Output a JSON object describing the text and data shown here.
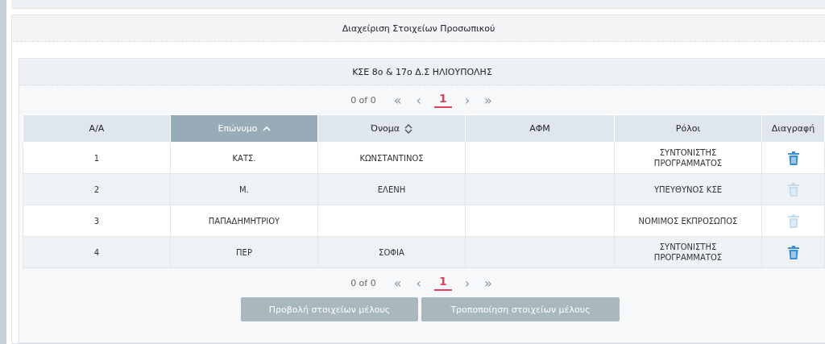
{
  "panel": {
    "title": "Διαχείριση Στοιχείων Προσωπικού"
  },
  "group": {
    "title": "ΚΣΕ 8ο & 17ο Δ.Σ ΗΛΙΟΥΠΟΛΗΣ"
  },
  "pager_top": {
    "count": "0 of 0",
    "first": "«",
    "prev": "‹",
    "pages": [
      {
        "label": "1",
        "selected": true
      }
    ],
    "next": "›",
    "last": "»"
  },
  "table": {
    "columns": [
      {
        "label": "Α/Α",
        "kind": "plain",
        "selected": false
      },
      {
        "label": "Επώνυμο",
        "kind": "sorted",
        "selected": true
      },
      {
        "label": "Όνομα",
        "kind": "sortable",
        "selected": false
      },
      {
        "label": "ΑΦΜ",
        "kind": "plain",
        "selected": false
      },
      {
        "label": "Ρόλοι",
        "kind": "plain",
        "selected": false
      },
      {
        "label": "Διαγραφή",
        "kind": "plain",
        "selected": false
      }
    ],
    "rows": [
      {
        "cells": [
          "1",
          "ΚΑΤΣ.",
          "ΚΩΝΣΤΑΝΤΙΝΟΣ",
          "",
          "ΣΥΝΤΟΝΙΣΤΗΣ ΠΡΟΓΡΑΜΜΑΤΟΣ"
        ],
        "delete_disabled": false
      },
      {
        "cells": [
          "2",
          "Μ.",
          "ΕΛΕΝΗ",
          "",
          "ΥΠΕΥΘΥΝΟΣ ΚΣΕ"
        ],
        "delete_disabled": true
      },
      {
        "cells": [
          "3",
          "ΠΑΠΑΔΗΜΗΤΡΙΟΥ",
          "",
          "",
          "ΝΟΜΙΜΟΣ ΕΚΠΡΟΣΩΠΟΣ"
        ],
        "delete_disabled": true
      },
      {
        "cells": [
          "4",
          "ΠΕΡ",
          "ΣΟΦΙΑ",
          "",
          "ΣΥΝΤΟΝΙΣΤΗΣ ΠΡΟΓΡΑΜΜΑΤΟΣ"
        ],
        "delete_disabled": false
      }
    ]
  },
  "pager_bottom": {
    "count": "0 of 0",
    "first": "«",
    "prev": "‹",
    "pages": [
      {
        "label": "1",
        "selected": true
      }
    ],
    "next": "›",
    "last": "»"
  },
  "buttons": [
    {
      "label": "Προβολή στοιχείων μέλους",
      "disabled": true
    },
    {
      "label": "Τροποποίηση στοιχείων μέλους",
      "disabled": true
    }
  ]
}
